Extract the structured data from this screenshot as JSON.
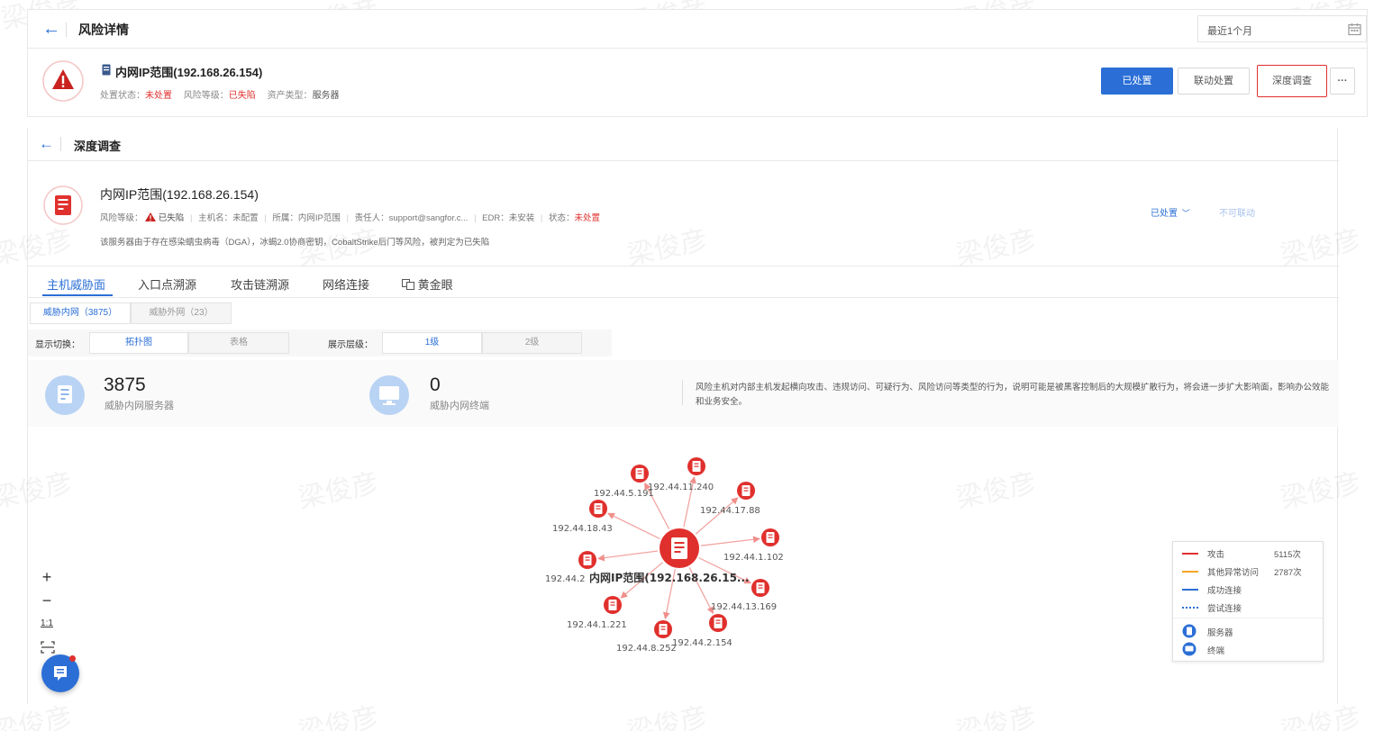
{
  "header": {
    "title": "风险详情",
    "date_range": "最近1个月"
  },
  "asset": {
    "name": "内网IP范围(192.168.26.154)",
    "status_label": "处置状态：",
    "status_value": "未处置",
    "level_label": "风险等级：",
    "level_value": "已失陷",
    "type_label": "资产类型：",
    "type_value": "服务器"
  },
  "actions": {
    "handled": "已处置",
    "linked": "联动处置",
    "deep": "深度调查",
    "more": "···"
  },
  "deep_panel": {
    "title": "深度调查",
    "asset_name": "内网IP范围(192.168.26.154)",
    "meta": {
      "level_label": "风险等级：",
      "level_value": "已失陷",
      "host_label": "主机名：",
      "host_value": "未配置",
      "belong_label": "所属：",
      "belong_value": "内网IP范围",
      "owner_label": "责任人：",
      "owner_value": "support@sangfor.c...",
      "edr_label": "EDR：",
      "edr_value": "未安装",
      "state_label": "状态：",
      "state_value": "未处置"
    },
    "description": "该服务器由于存在感染蠕虫病毒（DGA），冰蝎2.0协商密钥，CobaltStrike后门等风险，被判定为已失陷",
    "handled_dropdown": "已处置",
    "not_linkable": "不可联动"
  },
  "tabs": [
    "主机威胁面",
    "入口点溯源",
    "攻击链溯源",
    "网络连接",
    "黄金眼"
  ],
  "subtabs": [
    "威胁内网（3875）",
    "威胁外网（23）"
  ],
  "display_switch": {
    "label": "显示切换：",
    "options": [
      "拓扑图",
      "表格"
    ]
  },
  "display_level": {
    "label": "展示层级：",
    "options": [
      "1级",
      "2级"
    ]
  },
  "stats": {
    "servers_value": "3875",
    "servers_label": "威胁内网服务器",
    "terminals_value": "0",
    "terminals_label": "威胁内网终端",
    "note": "风险主机对内部主机发起横向攻击、违规访问、可疑行为、风险访问等类型的行为，说明可能是被黑客控制后的大规模扩散行为，将会进一步扩大影响面，影响办公效能和业务安全。"
  },
  "graph": {
    "center_label": "内网IP范围(192.168.26.15...",
    "nodes": [
      "192.44.11.240",
      "192.44.17.88",
      "192.44.1.102",
      "192.44.13.169",
      "192.44.2.154",
      "192.44.8.252",
      "192.44.1.221",
      "192.44.2",
      "192.44.18.43",
      "192.44.5.191"
    ]
  },
  "legend": {
    "attack": "攻击",
    "attack_count": "5115次",
    "abnormal": "其他异常访问",
    "abnormal_count": "2787次",
    "success": "成功连接",
    "attempt": "尝试连接",
    "server": "服务器",
    "terminal": "终端"
  },
  "zoom": {
    "plus": "+",
    "minus": "−",
    "fit": "1:1"
  },
  "watermark": "梁俊彦",
  "colors": {
    "primary": "#2b6fd6",
    "danger": "#e0302d",
    "node_red": "#e0302d",
    "edge_red": "#f2a6a3",
    "legend_orange": "#f5a623"
  }
}
